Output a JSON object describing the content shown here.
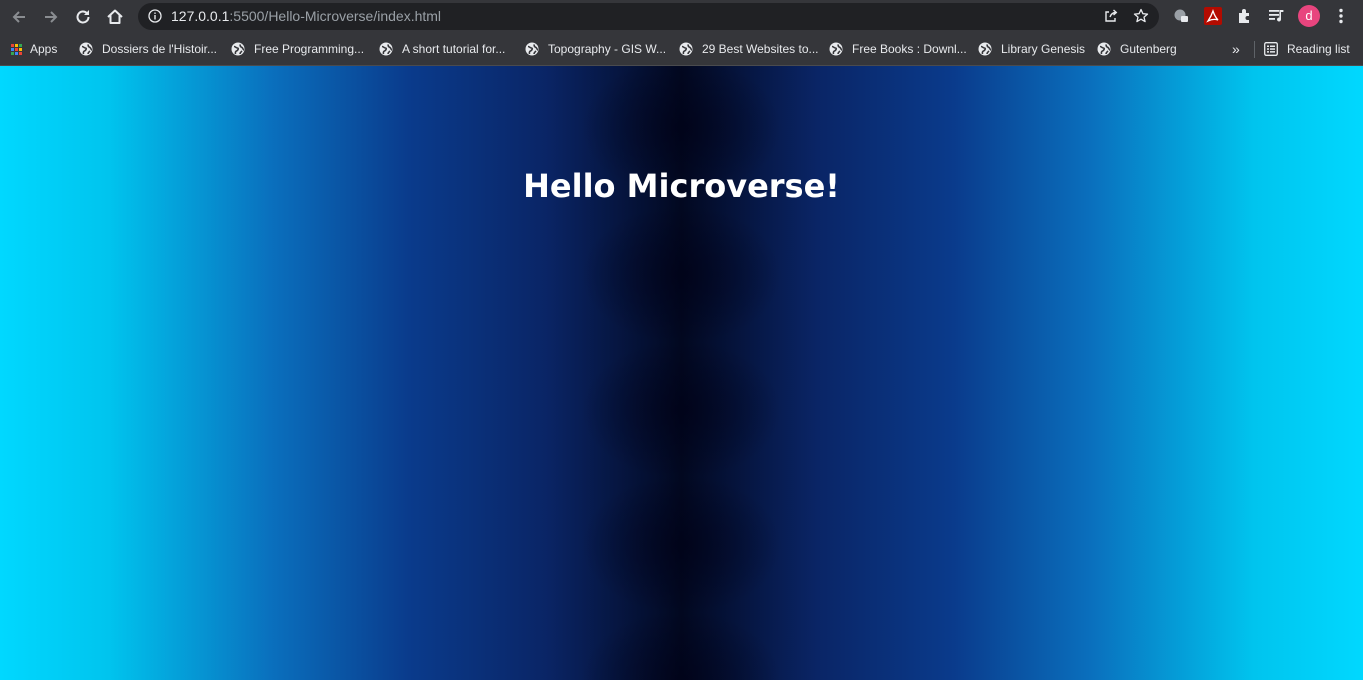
{
  "browser": {
    "url_host": "127.0.0.1",
    "url_rest": ":5500/Hello-Microverse/index.html",
    "avatar_letter": "d",
    "colors": {
      "toolbar": "#35363a",
      "omnibox": "#202124",
      "avatar": "#e8457e"
    }
  },
  "bookmarks": {
    "apps_label": "Apps",
    "items": [
      "Dossiers de l'Histoir...",
      "Free Programming...",
      "A short tutorial for...",
      "Topography - GIS W...",
      "29 Best Websites to...",
      "Free Books : Downl...",
      "Library Genesis",
      "Gutenberg"
    ],
    "overflow_label": "»",
    "reading_list_label": "Reading list"
  },
  "page": {
    "heading": "Hello Microverse!",
    "colors": {
      "edge": "#00d8ff",
      "center": "#020820",
      "heading": "#ffffff"
    }
  }
}
